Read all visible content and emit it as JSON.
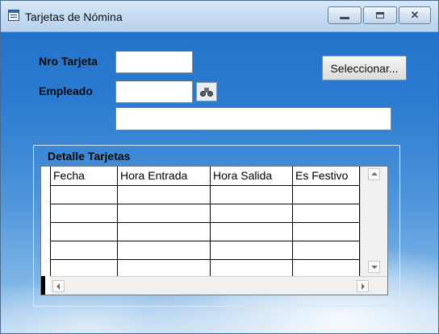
{
  "window": {
    "title": "Tarjetas de Nómina"
  },
  "form": {
    "nro_tarjeta_label": "Nro Tarjeta",
    "nro_tarjeta_value": "",
    "empleado_label": "Empleado",
    "empleado_code_value": "",
    "empleado_name_value": "",
    "select_button": "Seleccionar..."
  },
  "detail": {
    "title": "Detalle Tarjetas",
    "columns": [
      "Fecha",
      "Hora Entrada",
      "Hora Salida",
      "Es Festivo"
    ],
    "rows": []
  },
  "icons": {
    "app": "table-window-icon",
    "lookup": "binoculars-icon"
  },
  "colors": {
    "background_top": "#1f6fc8",
    "background_bottom": "#b9d6f1",
    "titlebar": "#c8dcf1"
  }
}
